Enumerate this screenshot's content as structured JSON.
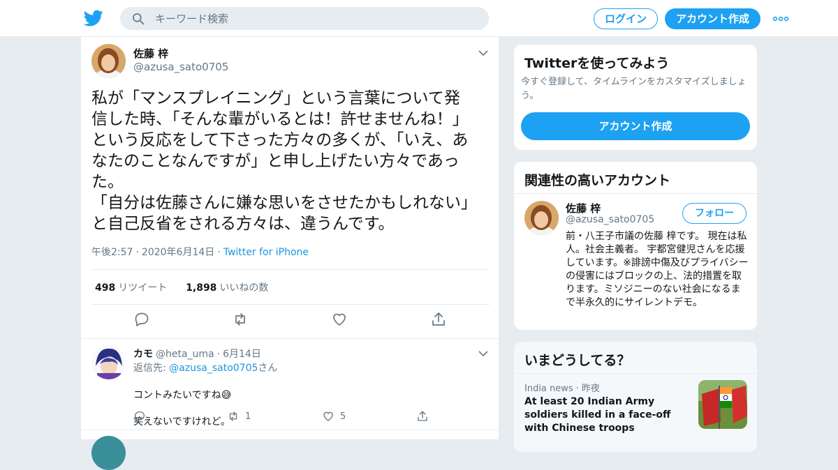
{
  "header": {
    "search_placeholder": "キーワード検索",
    "login_label": "ログイン",
    "signup_label": "アカウント作成",
    "brand_color": "#1da1f2"
  },
  "tweet": {
    "display_name": "佐藤 梓",
    "handle": "@azusa_sato0705",
    "body_lines": [
      "私が「マンスプレイニング」という言葉について発",
      "信した時、「そんな輩がいるとは！許せませんね！」",
      "という反応をして下さった方々の多くが、「いえ、あ",
      "なたのことなんですが」と申し上げたい方々であっ",
      "た。",
      "「自分は佐藤さんに嫌な思いをさせたかもしれない」",
      "と自己反省をされる方々は、違うんです。"
    ],
    "time": "午後2:57",
    "date": "2020年6月14日",
    "source": "Twitter for iPhone",
    "retweets_count": "498",
    "retweets_label": "リツイート",
    "likes_count": "1,898",
    "likes_label": "いいねの数"
  },
  "reply": {
    "display_name": "カモ",
    "handle": "@heta_uma",
    "date": "6月14日",
    "reply_to_prefix": "返信先: ",
    "reply_to_handle": "@azusa_sato0705",
    "reply_to_suffix": "さん",
    "body_line1": "コントみたいですね😅",
    "body_line2": "笑えないですけれど。",
    "retweets": "1",
    "likes": "5"
  },
  "sidebar": {
    "try_title": "Twitterを使ってみよう",
    "try_desc": "今すぐ登録して、タイムラインをカスタマイズしましょう。",
    "try_cta": "アカウント作成",
    "related_title": "関連性の高いアカウント",
    "related_name": "佐藤 梓",
    "related_handle": "@azusa_sato0705",
    "follow_label": "フォロー",
    "related_bio": "前・八王子市議の佐藤 梓です。 現在は私人。社会主義者。 宇都宮健児さんを応援しています。※誹謗中傷及びプライバシーの侵害にはブロックの上、法的措置を取ります。ミソジニーのない社会になるまで半永久的にサイレントデモ。",
    "trends_title": "いまどうしてる？",
    "trend_source": "India news",
    "trend_time": "昨夜",
    "trend_headline": "At least 20 Indian Army soldiers killed in a face-off with Chinese troops"
  }
}
